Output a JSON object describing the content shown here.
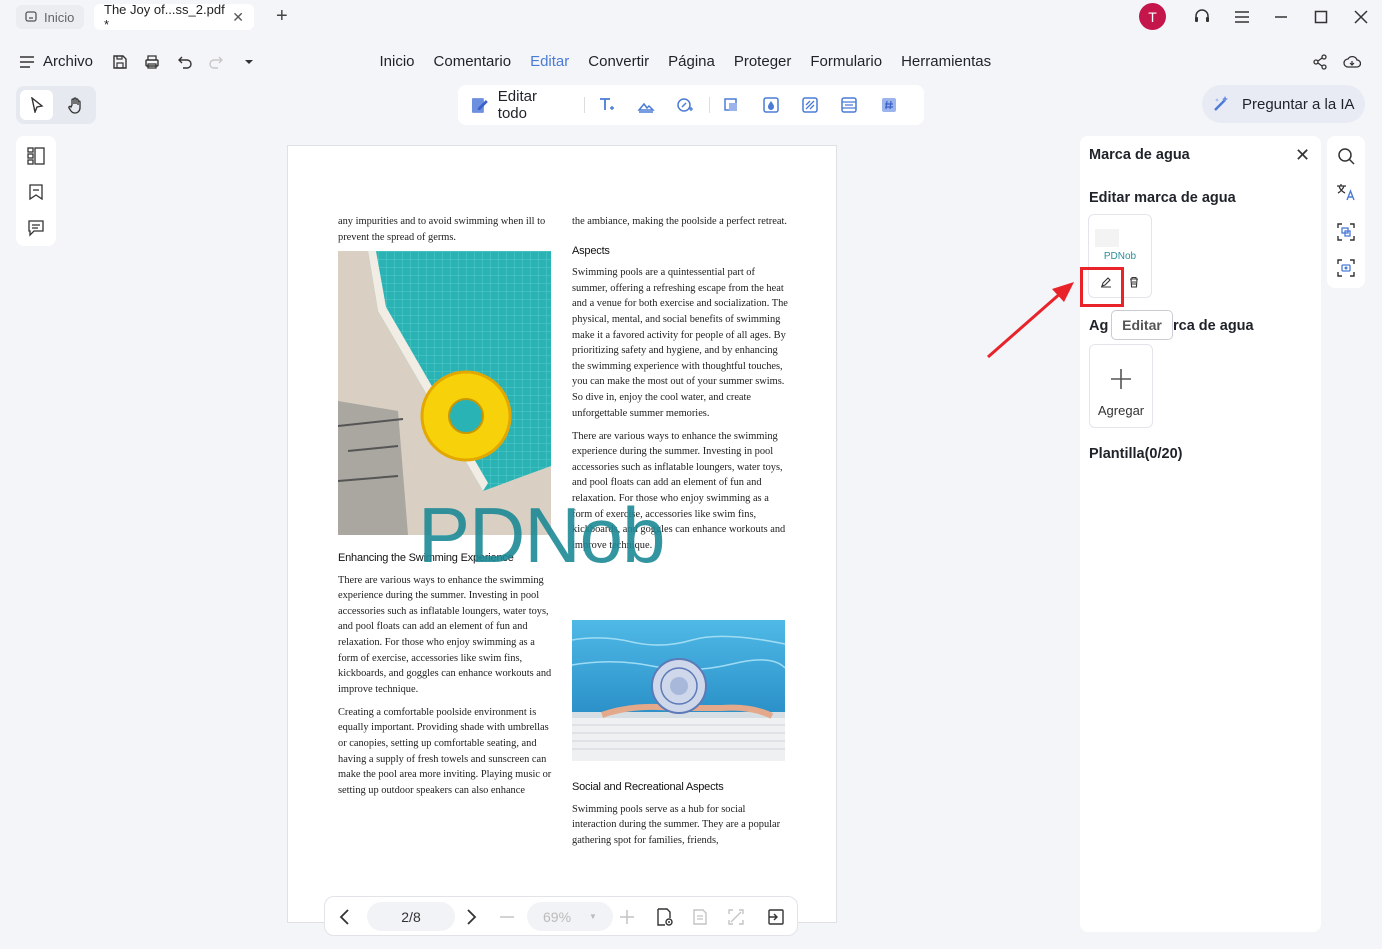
{
  "titlebar": {
    "home_tab": "Inicio",
    "doc_tab": "The Joy of...ss_2.pdf *",
    "avatar_letter": "T"
  },
  "menubar": {
    "archivo": "Archivo",
    "items": [
      "Inicio",
      "Comentario",
      "Editar",
      "Convertir",
      "Página",
      "Proteger",
      "Formulario",
      "Herramientas"
    ],
    "active": "Editar"
  },
  "toolbar": {
    "edit_all": "Editar todo",
    "ask_ai": "Preguntar a la IA"
  },
  "document": {
    "col1_intro": "any impurities and to avoid swimming when ill to prevent the spread of germs.",
    "col1_heading": "Enhancing the Swimming Experience",
    "col1_p1": "There are various ways to enhance the swimming experience during the summer. Investing in pool accessories such as inflatable loungers, water toys, and pool floats can add an element of fun and relaxation. For those who enjoy swimming as a form of exercise, accessories like swim fins, kickboards, and goggles can enhance workouts and improve technique.",
    "col1_p2": "Creating a comfortable poolside environment is equally important. Providing shade with umbrellas or canopies, setting up comfortable seating, and having a supply of fresh towels and sunscreen can make the pool area more inviting. Playing music or setting up outdoor speakers can also enhance",
    "col2_intro": "the ambiance, making the poolside a perfect retreat.",
    "col2_heading": "Aspects",
    "col2_p1": "Swimming pools are a quintessential part of summer, offering a refreshing escape from the heat and a venue for both exercise and socialization. The physical, mental, and social benefits of swimming make it a favored activity for people of all ages. By prioritizing safety and hygiene, and by enhancing the swimming experience with thoughtful touches, you can make the most out of your summer swims. So dive in, enjoy the cool water, and create unforgettable summer memories.",
    "col2_p2": "There are various ways to enhance the swimming experience during the summer. Investing in pool accessories such as inflatable loungers, water toys, and pool floats can add an element of fun and relaxation. For those who enjoy swimming as a form of exercise, accessories like swim fins, kickboards, and goggles can enhance workouts and improve technique.",
    "col2_heading2": "Social and Recreational Aspects",
    "col2_p3": "Swimming pools serve as a hub for social interaction during the summer. They are a popular gathering spot for families, friends,",
    "watermark": "PDNob"
  },
  "bottombar": {
    "page": "2/8",
    "zoom": "69%"
  },
  "panel": {
    "title": "Marca de agua",
    "edit_heading": "Editar marca de agua",
    "thumb_label": "PDNob",
    "tooltip": "Editar",
    "add_heading_left": "Ag",
    "add_heading_right": "rca de agua",
    "add_label": "Agregar",
    "template_heading": "Plantilla(0/20)"
  },
  "colors": {
    "accent": "#4a7bd6",
    "watermark": "#1e8a96",
    "highlight": "#e8232a",
    "avatar": "#c5164b"
  }
}
